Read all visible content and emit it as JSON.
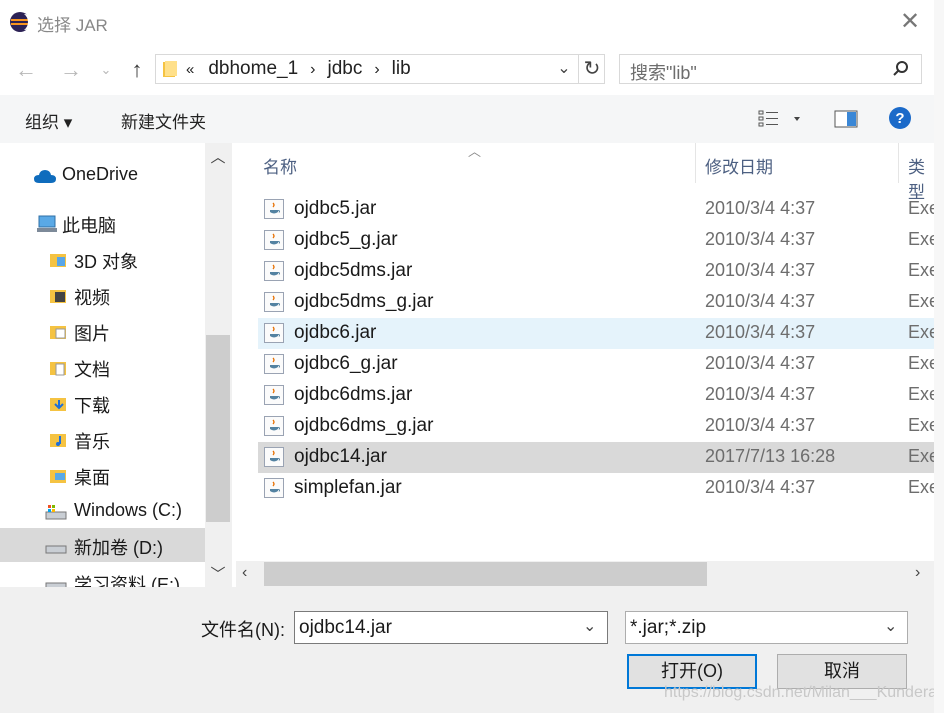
{
  "window": {
    "title": "选择 JAR"
  },
  "address": {
    "prefix": "«",
    "crumbs": [
      "dbhome_1",
      "jdbc",
      "lib"
    ]
  },
  "search": {
    "placeholder": "搜索\"lib\""
  },
  "toolbar": {
    "organize": "组织 ▾",
    "new_folder": "新建文件夹"
  },
  "sidebar": {
    "items": [
      {
        "label": "OneDrive",
        "icon": "cloud-icon"
      },
      {
        "label": "此电脑",
        "icon": "computer-icon"
      },
      {
        "label": "3D 对象",
        "icon": "folder-3d-icon"
      },
      {
        "label": "视频",
        "icon": "folder-video-icon"
      },
      {
        "label": "图片",
        "icon": "folder-pictures-icon"
      },
      {
        "label": "文档",
        "icon": "folder-documents-icon"
      },
      {
        "label": "下载",
        "icon": "folder-download-icon"
      },
      {
        "label": "音乐",
        "icon": "folder-music-icon"
      },
      {
        "label": "桌面",
        "icon": "folder-desktop-icon"
      },
      {
        "label": "Windows (C:)",
        "icon": "drive-c-icon"
      },
      {
        "label": "新加卷 (D:)",
        "icon": "drive-icon",
        "selected": true
      },
      {
        "label": "学习资料 (E:)",
        "icon": "drive-icon"
      }
    ]
  },
  "columns": {
    "name": "名称",
    "modified": "修改日期",
    "type": "类型"
  },
  "files": [
    {
      "name": "ojdbc5.jar",
      "date": "2010/3/4 4:37",
      "type": "Exe"
    },
    {
      "name": "ojdbc5_g.jar",
      "date": "2010/3/4 4:37",
      "type": "Exe"
    },
    {
      "name": "ojdbc5dms.jar",
      "date": "2010/3/4 4:37",
      "type": "Exe"
    },
    {
      "name": "ojdbc5dms_g.jar",
      "date": "2010/3/4 4:37",
      "type": "Exe"
    },
    {
      "name": "ojdbc6.jar",
      "date": "2010/3/4 4:37",
      "type": "Exe",
      "state": "hover"
    },
    {
      "name": "ojdbc6_g.jar",
      "date": "2010/3/4 4:37",
      "type": "Exe"
    },
    {
      "name": "ojdbc6dms.jar",
      "date": "2010/3/4 4:37",
      "type": "Exe"
    },
    {
      "name": "ojdbc6dms_g.jar",
      "date": "2010/3/4 4:37",
      "type": "Exe"
    },
    {
      "name": "ojdbc14.jar",
      "date": "2017/7/13 16:28",
      "type": "Exe",
      "state": "selected"
    },
    {
      "name": "simplefan.jar",
      "date": "2010/3/4 4:37",
      "type": "Exe"
    }
  ],
  "footer": {
    "filename_label": "文件名(N):",
    "filename_value": "ojdbc14.jar",
    "filter_value": "*.jar;*.zip",
    "open_label": "打开(O)",
    "cancel_label": "取消",
    "watermark": "https://blog.csdn.net/Milan___Kundera"
  },
  "colors": {
    "accent": "#0078d7",
    "selected_row": "#d9d9d9",
    "hover_row": "#e5f3fb",
    "help_icon": "#1b6ac9"
  }
}
